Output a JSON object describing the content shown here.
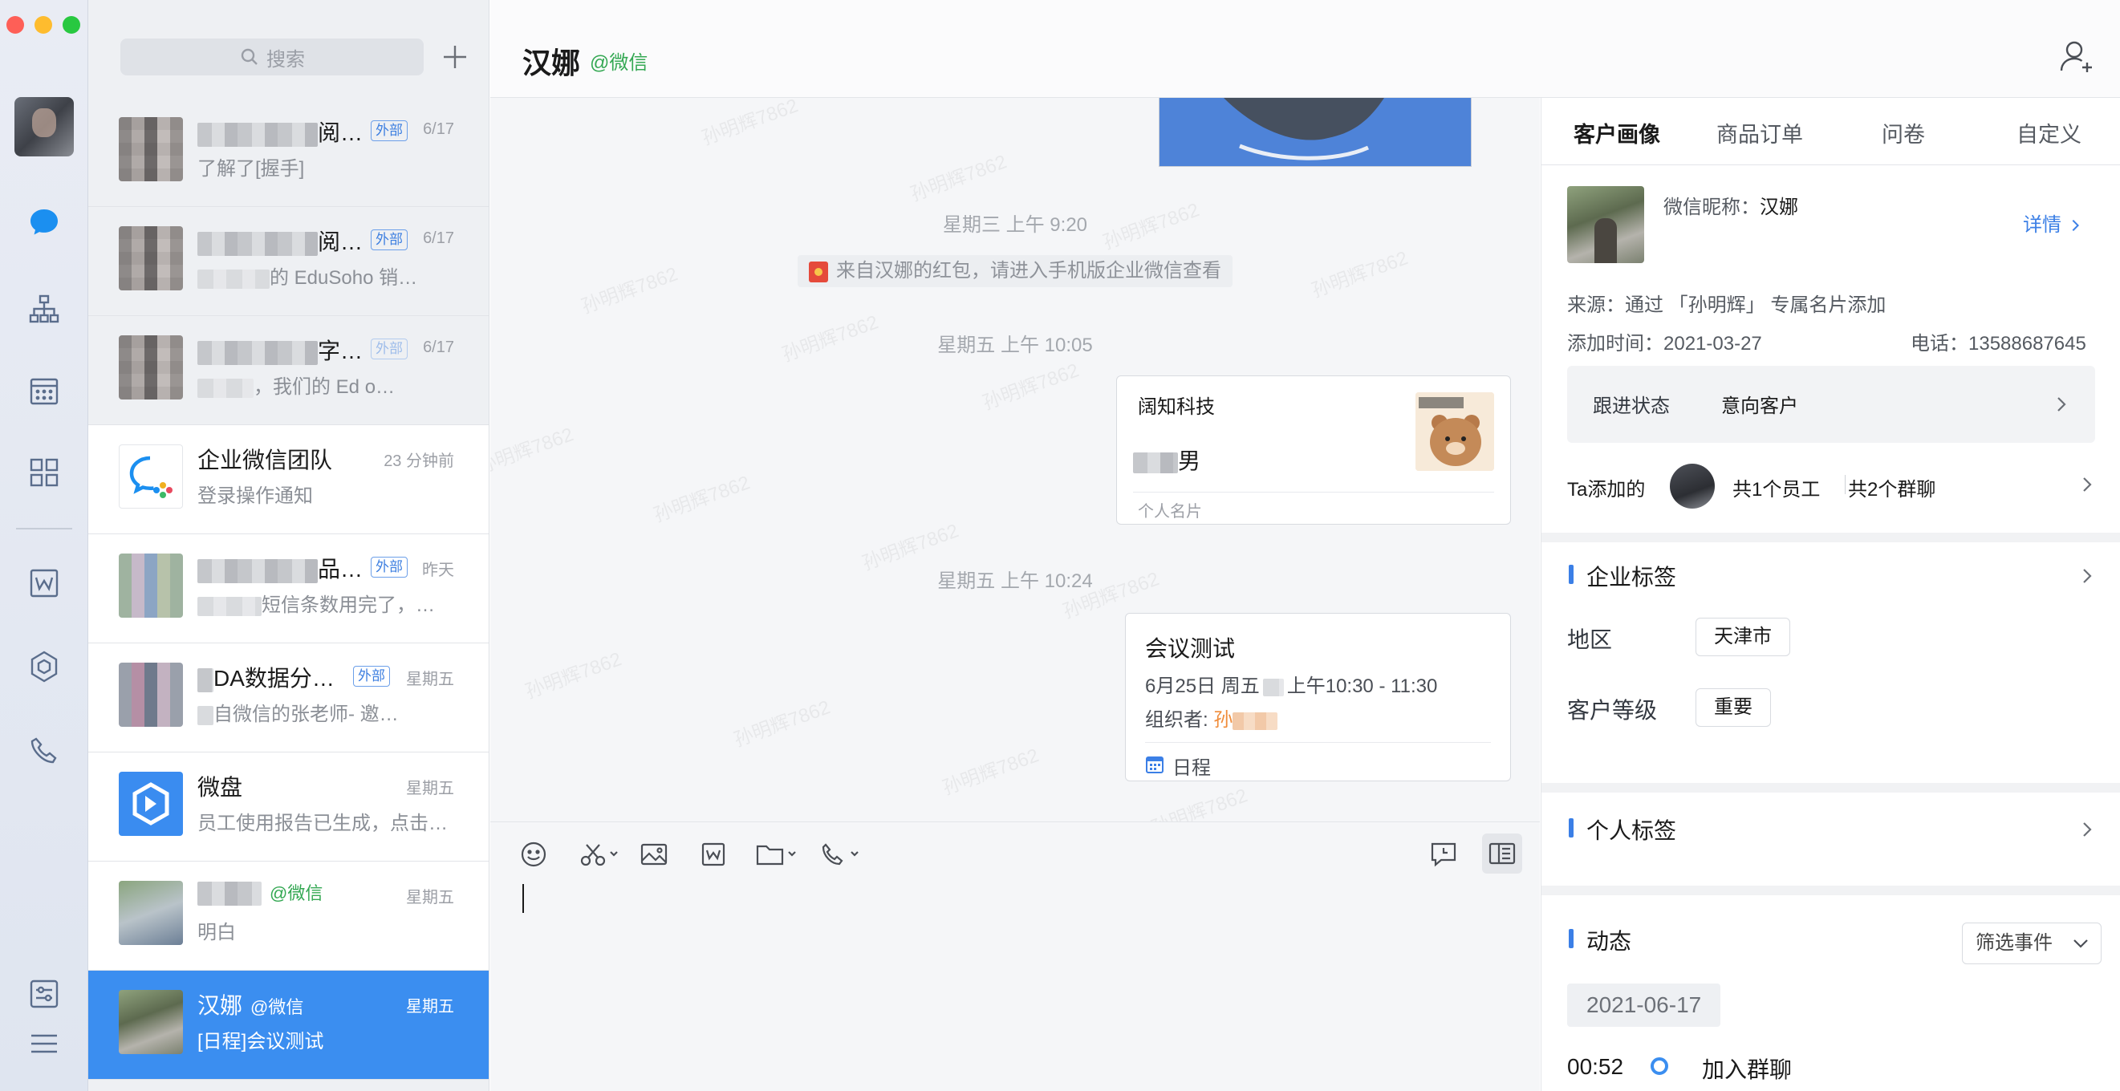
{
  "window": {
    "controls": [
      "close",
      "minimize",
      "maximize"
    ],
    "colors": {
      "close": "#fe5f57",
      "minimize": "#febc2e",
      "maximize": "#28c840"
    }
  },
  "rail": {
    "icons": [
      "message-icon",
      "org-chart-icon",
      "calendar-icon",
      "apps-grid-icon",
      "doc-w-icon",
      "hexagon-icon",
      "phone-icon",
      "settings-sliders-icon",
      "menu-icon"
    ],
    "accent": "#1b8ff0"
  },
  "list": {
    "search_placeholder": "搜索",
    "conversations": [
      {
        "name_suffix": "阅…",
        "badge": "外部",
        "time": "6/17",
        "preview": "了解了[握手]",
        "preview_blur": false
      },
      {
        "name_suffix": "阅…",
        "badge": "外部",
        "time": "6/17",
        "preview": "的 EduSoho 销…",
        "preview_blur": true
      },
      {
        "name_suffix": "字…",
        "badge": "外部",
        "time": "6/17",
        "preview": "，我们的 Ed    o…",
        "preview_blur": true
      },
      {
        "name": "企业微信团队",
        "time": "23 分钟前",
        "preview": "登录操作通知"
      },
      {
        "name_suffix": "品…",
        "badge": "外部",
        "time": "昨天",
        "preview": "短信条数用完了，…",
        "preview_blur": true
      },
      {
        "name_suffix": "DA数据分…",
        "badge": "外部",
        "time": "星期五",
        "preview": "自微信的张老师-     邀…",
        "preview_blur": true
      },
      {
        "name": "微盘",
        "time": "星期五",
        "preview": "员工使用报告已生成，点击…"
      },
      {
        "wx": "@微信",
        "time": "星期五",
        "preview": "明白"
      },
      {
        "name": "汉娜",
        "wx": "@微信",
        "time": "星期五",
        "preview": "[日程]会议测试"
      }
    ]
  },
  "chat": {
    "title": "汉娜",
    "title_wx": "@微信",
    "watermark": "孙明辉7862",
    "timestamps": [
      "星期三 上午 9:20",
      "星期五 上午 10:05",
      "星期五 上午 10:24"
    ],
    "redpack_text": "来自汉娜的红包，请进入手机版企业微信查看",
    "namecard": {
      "company": "阔知科技",
      "name": "男",
      "type": "个人名片"
    },
    "meeting": {
      "title": "会议测试",
      "date_prefix": "6月25日 周五",
      "time_range": "上午10:30 - 11:30",
      "organizer_label": "组织者: ",
      "organizer": "孙",
      "kind": "日程"
    },
    "toolbar": [
      "emoji-icon",
      "scissors-icon",
      "image-icon",
      "word-doc-icon",
      "folder-icon",
      "phone-call-icon",
      "chat-history-icon",
      "sidebar-toggle-icon"
    ]
  },
  "panel": {
    "tabs": [
      "客户画像",
      "商品订单",
      "问卷",
      "自定义"
    ],
    "profile": {
      "nickname_label": "微信昵称：",
      "nickname": "汉娜",
      "detail_link": "详情",
      "source": "来源：通过 「孙明辉」 专属名片添加",
      "add_time": "添加时间：2021-03-27",
      "phone": "电话：13588687645"
    },
    "follow": {
      "label": "跟进状态",
      "value": "意向客户"
    },
    "added_by": {
      "label": "Ta添加的",
      "employees": "共1个员工",
      "groups": "共2个群聊"
    },
    "company_tags": {
      "title": "企业标签",
      "rows": [
        {
          "label": "地区",
          "value": "天津市"
        },
        {
          "label": "客户等级",
          "value": "重要"
        }
      ]
    },
    "personal_tags": {
      "title": "个人标签"
    },
    "activity": {
      "title": "动态",
      "filter": "筛选事件",
      "date": "2021-06-17",
      "event_time": "00:52",
      "event_name": "加入群聊"
    }
  }
}
